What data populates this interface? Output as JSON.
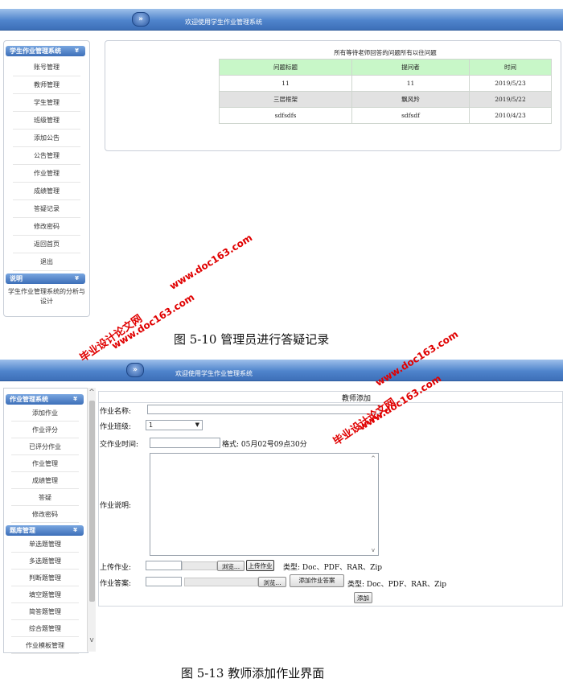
{
  "fig1": {
    "welcome": "欢迎使用学生作业管理系统",
    "sidebar_title": "学生作业管理系统",
    "menu_items": [
      "账号管理",
      "教师管理",
      "学生管理",
      "班级管理",
      "添加公告",
      "公告管理",
      "作业管理",
      "成绩管理",
      "答疑记录",
      "修改密码",
      "返回首页",
      "退出"
    ],
    "info_title": "说明",
    "info_text_line1": "学生作业管理系统的分析与",
    "info_text_line2": "设计",
    "table_heading": "所有等待老师回答的问题所有以往问题",
    "columns": [
      "问题标题",
      "提问者",
      "时间"
    ],
    "rows": [
      [
        "11",
        "11",
        "2019/5/23"
      ],
      [
        "三层框架",
        "飘风羚",
        "2019/5/22"
      ],
      [
        "sdfsdfs",
        "sdfsdf",
        "2010/4/23"
      ]
    ],
    "caption": "图 5-10   管理员进行答疑记录"
  },
  "fig2": {
    "welcome": "欢迎使用学生作业管理系统",
    "sidebar_title": "作业管理系统",
    "menu_items": [
      "添加作业",
      "作业评分",
      "已评分作业",
      "作业管理",
      "成绩管理",
      "答疑",
      "修改密码"
    ],
    "bank_title": "题库管理",
    "bank_items": [
      "单选题管理",
      "多选题管理",
      "判断题管理",
      "填空题管理",
      "简答题管理",
      "综合题管理",
      "作业模板管理"
    ],
    "form_title": "教师添加",
    "name_label": "作业名称:",
    "class_label": "作业班级:",
    "class_value": "1",
    "time_label": "交作业时间:",
    "time_hint": "格式: 05月02号09点30分",
    "desc_label": "作业说明:",
    "upload_label": "上传作业:",
    "browse_label": "浏览...",
    "upload_button": "上传作业",
    "upload_types": "类型: Doc、PDF、RAR、Zip",
    "answer_label": "作业答案:",
    "add_answer_button": "添加作业答案",
    "add_button": "添加",
    "caption": "图 5-13    教师添加作业界面"
  },
  "watermarks": {
    "site": "www.doc163.com",
    "label": "毕业设计论文网"
  },
  "colors": {
    "header_blue": "#4f84cc",
    "table_header_green": "#c8f7c8",
    "watermark_red": "#e00000"
  }
}
